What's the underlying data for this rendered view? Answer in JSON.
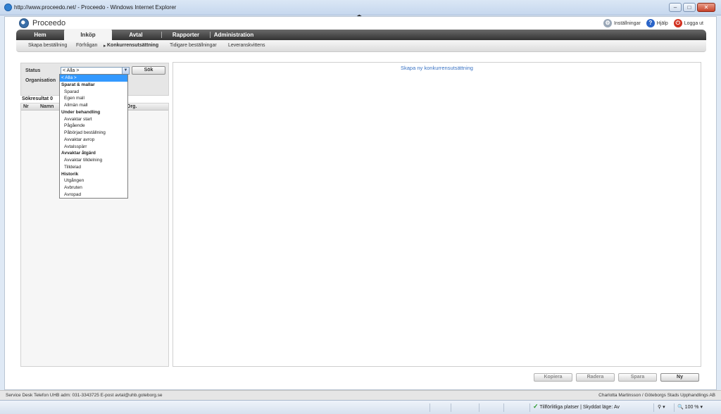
{
  "window": {
    "title": "http://www.proceedo.net/ - Proceedo - Windows Internet Explorer",
    "buttons": [
      "–",
      "□",
      "✕"
    ]
  },
  "app": {
    "name": "Proceedo",
    "toplinks": [
      {
        "label": "Inställningar",
        "icon": "gear-icon"
      },
      {
        "label": "Hjälp",
        "icon": "help-icon"
      },
      {
        "label": "Logga ut",
        "icon": "power-icon"
      }
    ]
  },
  "nav": {
    "tabs": [
      "Hem",
      "Inköp",
      "Avtal",
      "Rapporter",
      "Administration"
    ],
    "active": "Inköp"
  },
  "subnav": {
    "items": [
      "Skapa beställning",
      "Förfrågan",
      "Konkurrensutsättning",
      "Tidigare beställningar",
      "Leveranskvittens"
    ],
    "active": "Konkurrensutsättning",
    "marker": "▸"
  },
  "filter": {
    "status_label": "Status",
    "organisation_label": "Organisation",
    "status_value": "< Alla >",
    "search_button": "Sök"
  },
  "results": {
    "label": "Sökresultat 0",
    "columns": [
      "Nr",
      "Namn",
      "Org."
    ]
  },
  "dropdown": {
    "options": [
      {
        "label": "< Alla >",
        "kind": "selected"
      },
      {
        "label": "Sparat & mallar",
        "kind": "group"
      },
      {
        "label": "Sparad",
        "kind": "item"
      },
      {
        "label": "Egen mall",
        "kind": "item"
      },
      {
        "label": "Allmän mall",
        "kind": "item"
      },
      {
        "label": "Under behandling",
        "kind": "group"
      },
      {
        "label": "Avvaktar start",
        "kind": "item"
      },
      {
        "label": "Pågående",
        "kind": "item"
      },
      {
        "label": "Påbörjad beställning",
        "kind": "item"
      },
      {
        "label": "Avvaktar avrop",
        "kind": "item"
      },
      {
        "label": "Avtalsspärr",
        "kind": "item"
      },
      {
        "label": "Avvaktar åtgärd",
        "kind": "group"
      },
      {
        "label": "Avvaktar tilldelning",
        "kind": "item"
      },
      {
        "label": "Tilldelad",
        "kind": "item"
      },
      {
        "label": "Historik",
        "kind": "group"
      },
      {
        "label": "Utgången",
        "kind": "item"
      },
      {
        "label": "Avbruten",
        "kind": "item"
      },
      {
        "label": "Avropad",
        "kind": "item"
      }
    ]
  },
  "main": {
    "heading": "Skapa ny konkurrensutsättning"
  },
  "actions": {
    "copy": "Kopiera",
    "delete": "Radera",
    "save": "Spara",
    "new": "Ny"
  },
  "footer": {
    "left": "Service Desk Telefon UHB adm: 031-3343725   E-post avtal@uhb.goteborg.se",
    "right": "Charlotta Martinsson / Göteborgs Stads Upphandlings AB"
  },
  "status": {
    "zone": "Tillförlitliga platser | Skyddat läge: Av",
    "zoom": "100 %"
  },
  "colors": {
    "accent_link": "#3a73c4",
    "nav_dark": "#333333",
    "selection": "#3399ff"
  }
}
